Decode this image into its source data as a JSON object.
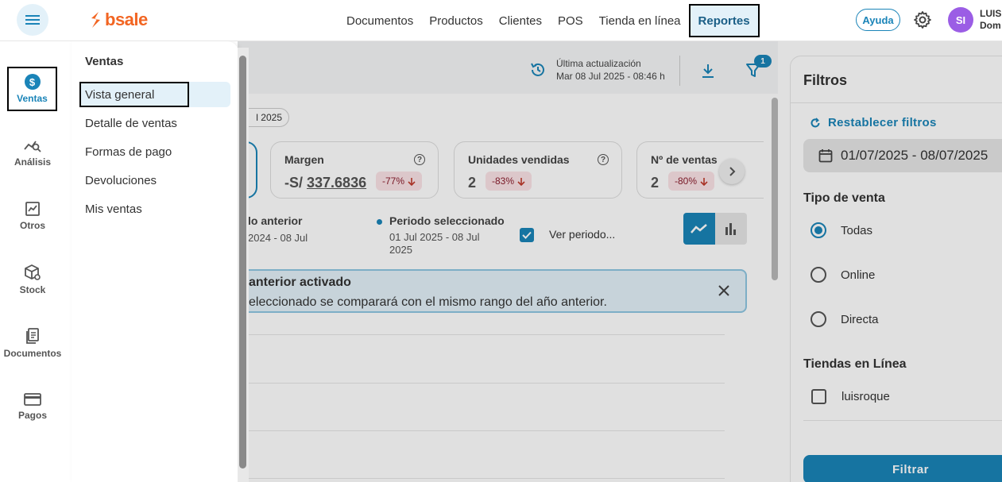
{
  "topbar": {
    "logo_text": "bsale",
    "nav": [
      {
        "label": "Documentos"
      },
      {
        "label": "Productos"
      },
      {
        "label": "Clientes"
      },
      {
        "label": "POS"
      },
      {
        "label": "Tienda en línea"
      },
      {
        "label": "Reportes",
        "active": true
      }
    ],
    "help_label": "Ayuda",
    "avatar_initials": "SI",
    "user_name_line1": "LUIS",
    "user_name_line2": "Dom"
  },
  "rail": {
    "items": [
      {
        "label": "Ventas",
        "icon": "dollar-icon",
        "active": true
      },
      {
        "label": "Análisis",
        "icon": "analysis-icon"
      },
      {
        "label": "Otros",
        "icon": "chart-icon"
      },
      {
        "label": "Stock",
        "icon": "box-icon"
      },
      {
        "label": "Documentos",
        "icon": "document-icon"
      },
      {
        "label": "Pagos",
        "icon": "card-icon"
      }
    ]
  },
  "submenu": {
    "title": "Ventas",
    "items": [
      {
        "label": "Vista general",
        "active": true
      },
      {
        "label": "Detalle de ventas"
      },
      {
        "label": "Formas de pago"
      },
      {
        "label": "Devoluciones"
      },
      {
        "label": "Mis ventas"
      }
    ]
  },
  "toolbar": {
    "update_label": "Última actualización",
    "update_time": "Mar 08 Jul 2025 - 08:46 h",
    "filter_badge": "1"
  },
  "content": {
    "date_pill": "l 2025",
    "kpis": [
      {
        "title": "Margen",
        "value_prefix": "-S/ ",
        "value": "337.6836",
        "delta": "-77%"
      },
      {
        "title": "Unidades vendidas",
        "value_prefix": "",
        "value": "2",
        "delta": "-83%"
      },
      {
        "title": "Nº de ventas",
        "value_prefix": "",
        "value": "2",
        "delta": "-80%"
      }
    ],
    "period_prev_title": "lo anterior",
    "period_prev_range": "2024 - 08 Jul",
    "period_sel_title": "Periodo seleccionado",
    "period_sel_range": "01 Jul 2025 - 08 Jul 2025",
    "ver_periodo_label": "Ver periodo...",
    "notice_title": "anterior activado",
    "notice_body": "eleccionado se comparará con el mismo rango del año anterior."
  },
  "filtros": {
    "title": "Filtros",
    "reset_label": "Restablecer filtros",
    "date_range": "01/07/2025 - 08/07/2025",
    "tipo_venta_title": "Tipo de venta",
    "tipo_venta_options": [
      {
        "label": "Todas",
        "selected": true
      },
      {
        "label": "Online",
        "selected": false
      },
      {
        "label": "Directa",
        "selected": false
      }
    ],
    "tiendas_title": "Tiendas en Línea",
    "tiendas_options": [
      {
        "label": "luisroque",
        "checked": false
      }
    ],
    "filter_button": "Filtrar"
  },
  "colors": {
    "accent": "#1a84b8",
    "brand": "#f26522",
    "avatar": "#9b5de5",
    "delta_bg": "#fbe3e6"
  }
}
